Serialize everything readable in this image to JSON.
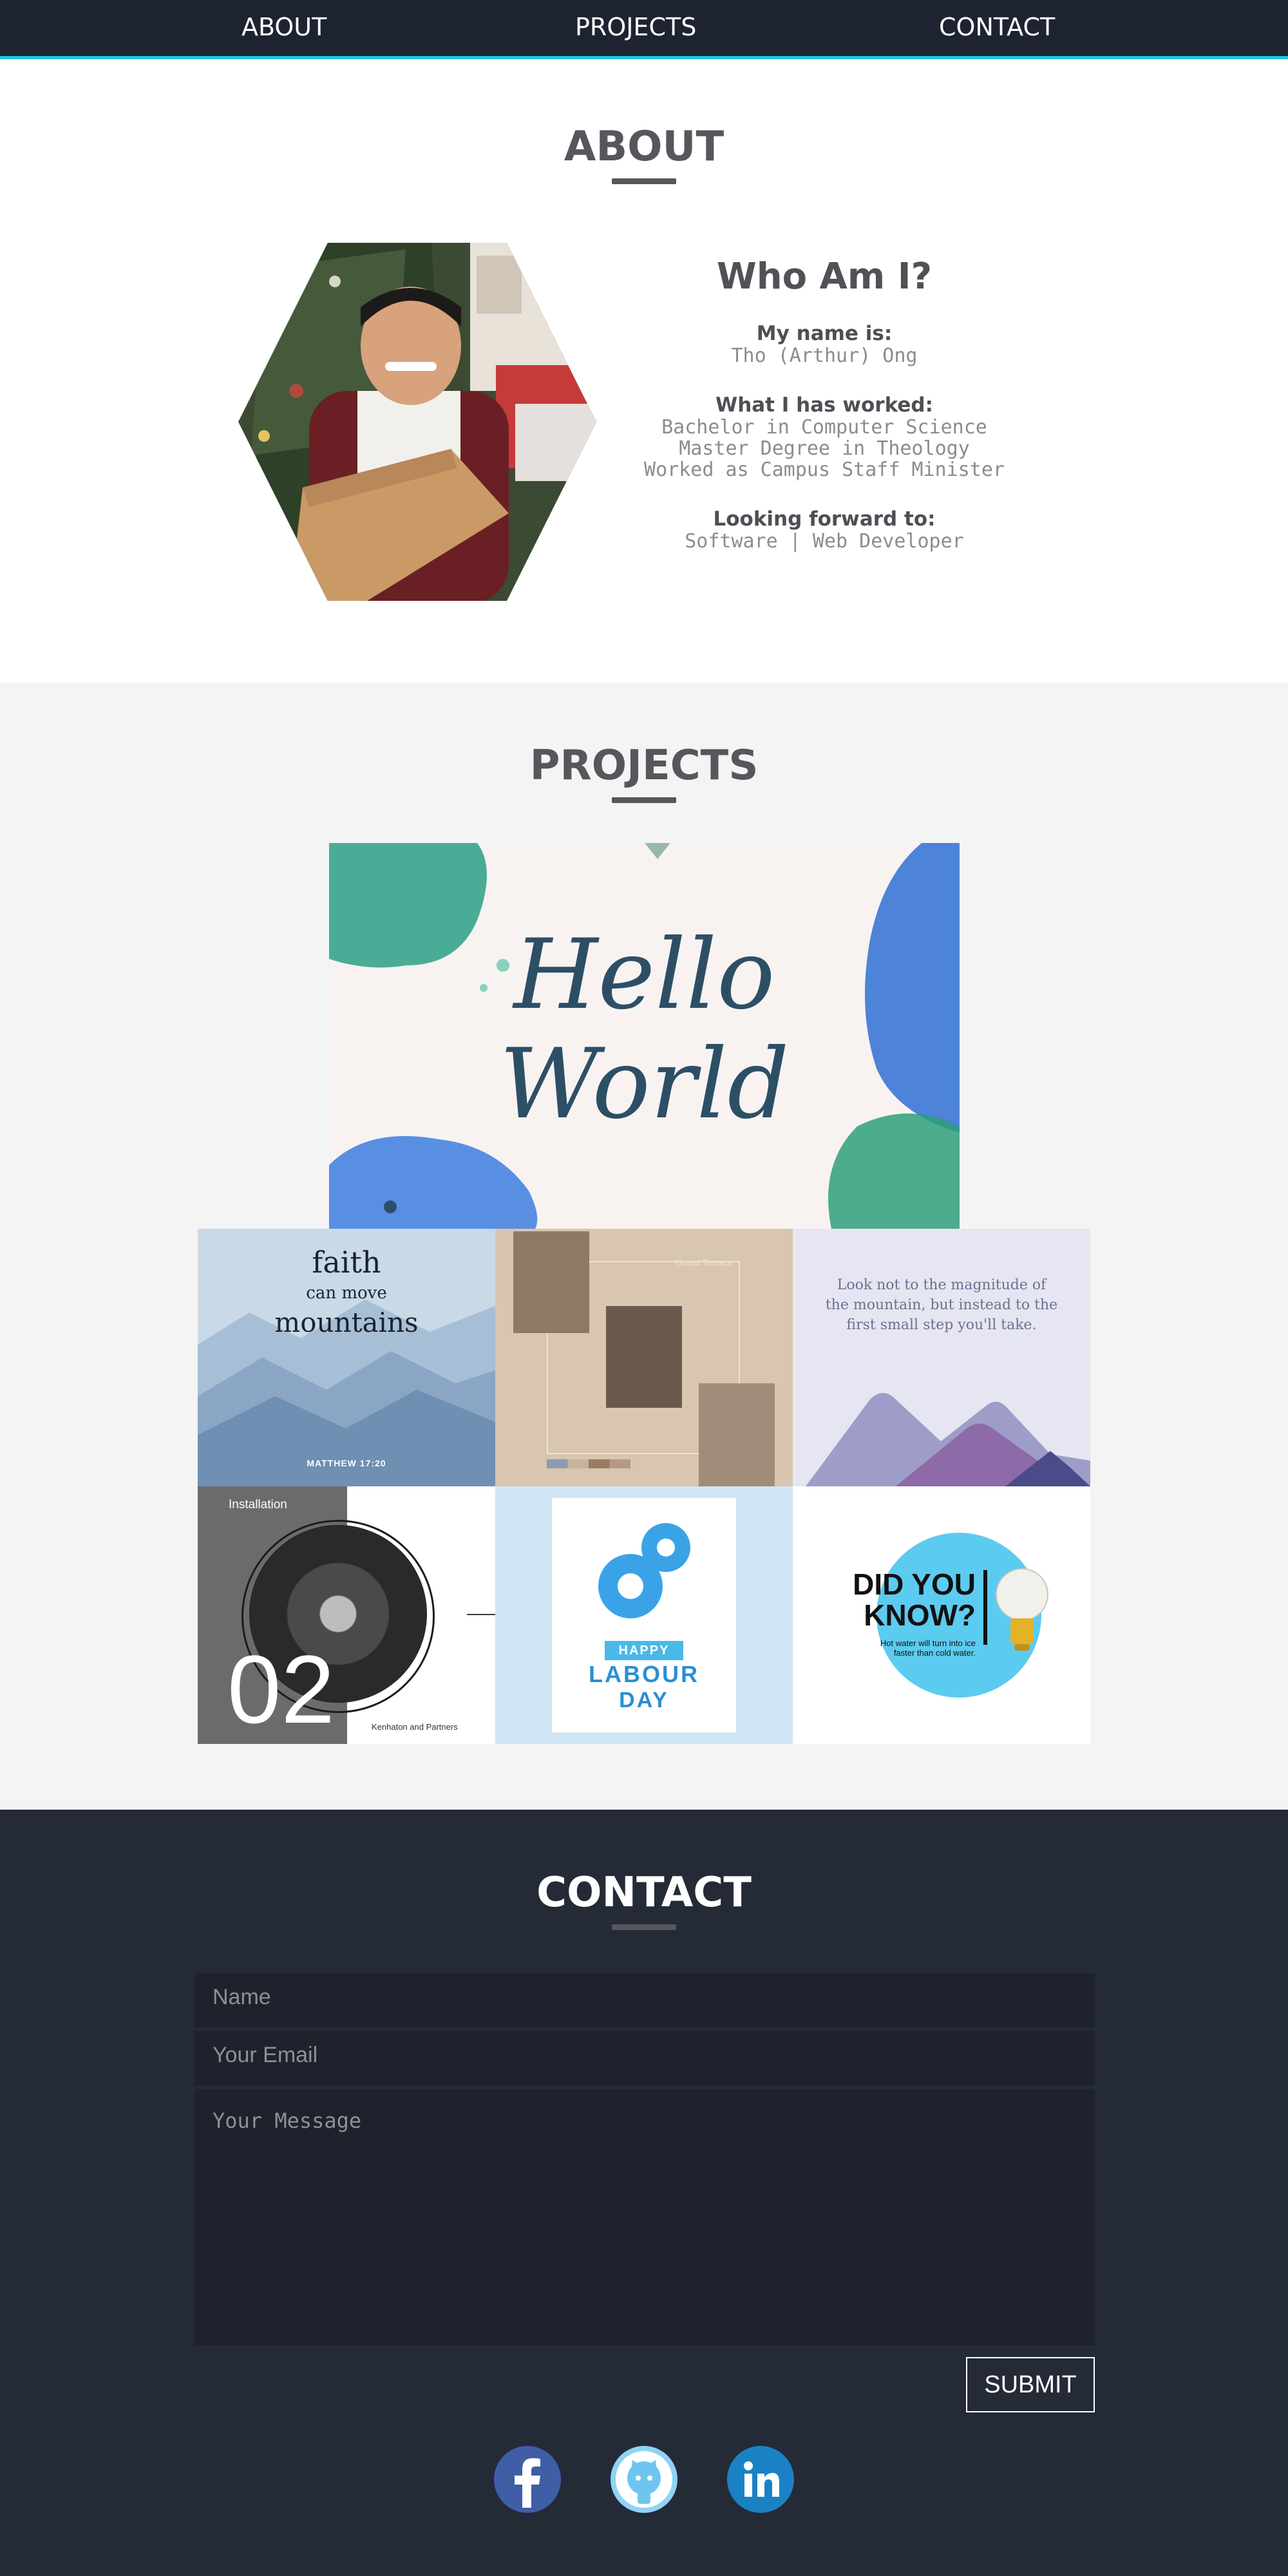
{
  "nav": {
    "items": [
      {
        "label": "ABOUT"
      },
      {
        "label": "PROJECTS"
      },
      {
        "label": "CONTACT"
      }
    ]
  },
  "about": {
    "title": "ABOUT",
    "heading": "Who Am I?",
    "name_label": "My name is:",
    "name_value": "Tho (Arthur) Ong",
    "worked_label": "What I has worked:",
    "worked_items": [
      "Bachelor in Computer Science",
      "Master Degree in Theology",
      "Worked as Campus Staff Minister"
    ],
    "forward_label": "Looking forward to:",
    "forward_value": "Software | Web Developer"
  },
  "projects": {
    "title": "PROJECTS",
    "featured": {
      "line1": "Hello",
      "line2": "World"
    },
    "tiles": [
      {
        "line1": "faith",
        "line2": "can move",
        "line3": "mountains",
        "caption": "MATTHEW 17:20"
      },
      {
        "caption": "Grand Terrace"
      },
      {
        "quote": "Look not to the magnitude of the mountain, but instead to the first small step you'll take."
      },
      {
        "label": "Installation",
        "number": "02",
        "caption": "Kenhaton and Partners"
      },
      {
        "ribbon": "HAPPY",
        "line1": "LABOUR",
        "line2": "DAY"
      },
      {
        "line1": "DID YOU",
        "line2": "KNOW?",
        "small": "Hot water will turn into ice faster than cold water."
      }
    ]
  },
  "contact": {
    "title": "CONTACT",
    "name_placeholder": "Name",
    "email_placeholder": "Your Email",
    "message_placeholder": "Your Message",
    "submit_label": "SUBMIT",
    "social": [
      "facebook-icon",
      "github-icon",
      "linkedin-icon"
    ]
  },
  "colors": {
    "nav_bg": "#1e2331",
    "nav_accent": "#22c4dc",
    "contact_bg": "#252a37",
    "projects_bg": "#f4f4f4",
    "title_grey": "#55575c"
  }
}
